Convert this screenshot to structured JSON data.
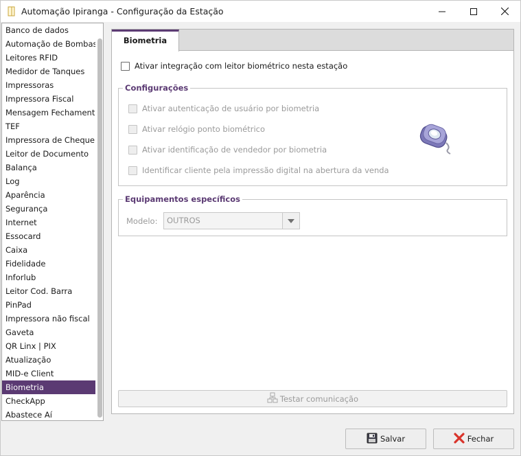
{
  "window": {
    "title": "Automação Ipiranga - Configuração da Estação"
  },
  "sidebar": {
    "selected_index": 26,
    "items": [
      {
        "label": "Banco de dados"
      },
      {
        "label": "Automação de Bombas"
      },
      {
        "label": "Leitores RFID"
      },
      {
        "label": "Medidor de Tanques"
      },
      {
        "label": "Impressoras"
      },
      {
        "label": "Impressora Fiscal"
      },
      {
        "label": "Mensagem Fechamento"
      },
      {
        "label": "TEF"
      },
      {
        "label": "Impressora de Cheque"
      },
      {
        "label": "Leitor de Documento"
      },
      {
        "label": "Balança"
      },
      {
        "label": "Log"
      },
      {
        "label": "Aparência"
      },
      {
        "label": "Segurança"
      },
      {
        "label": "Internet"
      },
      {
        "label": "Essocard"
      },
      {
        "label": "Caixa"
      },
      {
        "label": "Fidelidade"
      },
      {
        "label": "Inforlub"
      },
      {
        "label": "Leitor Cod. Barra"
      },
      {
        "label": "PinPad"
      },
      {
        "label": "Impressora não fiscal"
      },
      {
        "label": "Gaveta"
      },
      {
        "label": "QR Linx | PIX"
      },
      {
        "label": "Atualização"
      },
      {
        "label": "MID-e Client"
      },
      {
        "label": "Biometria"
      },
      {
        "label": "CheckApp"
      },
      {
        "label": "Abastece Aí"
      }
    ]
  },
  "tab": {
    "label": "Biometria"
  },
  "main": {
    "enable_integration_label": "Ativar integração com leitor biométrico nesta estação",
    "config_group": {
      "title": "Configurações",
      "options": [
        "Ativar autenticação de usuário por biometria",
        "Ativar relógio ponto biométrico",
        "Ativar identificação de vendedor por biometria",
        "Identificar cliente pela impressão digital na abertura da venda"
      ]
    },
    "equipment_group": {
      "title": "Equipamentos específicos",
      "model_label": "Modelo:",
      "model_value": "OUTROS"
    },
    "test_button_label": "Testar comunicação"
  },
  "footer": {
    "save_label": "Salvar",
    "close_label": "Fechar"
  },
  "colors": {
    "accent": "#5b3a73",
    "close_icon": "#d9342b"
  }
}
